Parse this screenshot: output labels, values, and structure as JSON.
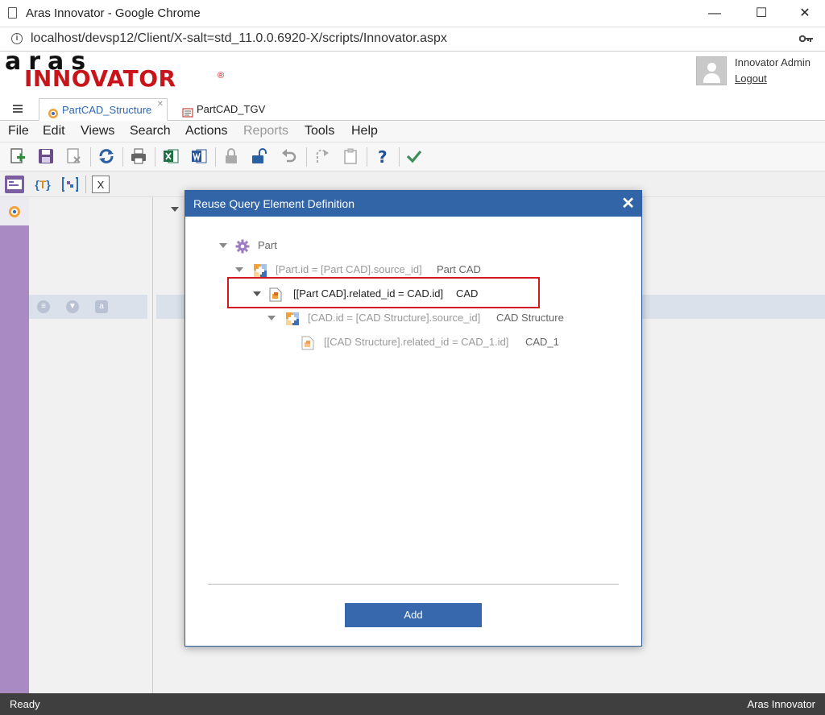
{
  "browser": {
    "window_title": "Aras Innovator - Google Chrome",
    "url": "localhost/devsp12/Client/X-salt=std_11.0.0.6920-X/scripts/Innovator.aspx",
    "minimize": "—",
    "maximize": "☐",
    "close": "✕"
  },
  "header": {
    "logo_top": "aras",
    "logo_bottom": "INNOVATOR",
    "logo_reg": "®",
    "user_name": "Innovator Admin",
    "logout": "Logout"
  },
  "tabs": [
    {
      "label": "PartCAD_Structure",
      "active": true
    },
    {
      "label": "PartCAD_TGV",
      "active": false
    }
  ],
  "menu": [
    {
      "label": "File",
      "disabled": false
    },
    {
      "label": "Edit",
      "disabled": false
    },
    {
      "label": "Views",
      "disabled": false
    },
    {
      "label": "Search",
      "disabled": false
    },
    {
      "label": "Actions",
      "disabled": false
    },
    {
      "label": "Reports",
      "disabled": true
    },
    {
      "label": "Tools",
      "disabled": false
    },
    {
      "label": "Help",
      "disabled": false
    }
  ],
  "toolbar_icons": [
    "new-item-icon",
    "save-icon",
    "delete-icon",
    "refresh-icon",
    "print-icon",
    "excel-icon",
    "word-icon",
    "lock-icon",
    "unlock-icon",
    "undo-icon",
    "promote-icon",
    "clipboard-icon",
    "help-icon",
    "done-icon"
  ],
  "colors": {
    "accent_blue": "#3265a8",
    "brand_red": "#c8151b",
    "rail_purple": "#a98ac2",
    "highlight_red": "#d4181f"
  },
  "dialog": {
    "title": "Reuse Query Element Definition",
    "close": "✕",
    "tree": [
      {
        "condition": "",
        "name": "Part",
        "icon": "gear-icon"
      },
      {
        "condition": "[Part.id = [Part CAD].source_id]",
        "name": "Part CAD",
        "icon": "relationship-icon"
      },
      {
        "condition": "[[Part CAD].related_id = CAD.id]",
        "name": "CAD",
        "icon": "cad-document-icon"
      },
      {
        "condition": "[CAD.id = [CAD Structure].source_id]",
        "name": "CAD Structure",
        "icon": "relationship-icon"
      },
      {
        "condition": "[[CAD Structure].related_id = CAD_1.id]",
        "name": "CAD_1",
        "icon": "cad-document-icon"
      }
    ],
    "add_label": "Add"
  },
  "status": {
    "left": "Ready",
    "right": "Aras Innovator"
  }
}
